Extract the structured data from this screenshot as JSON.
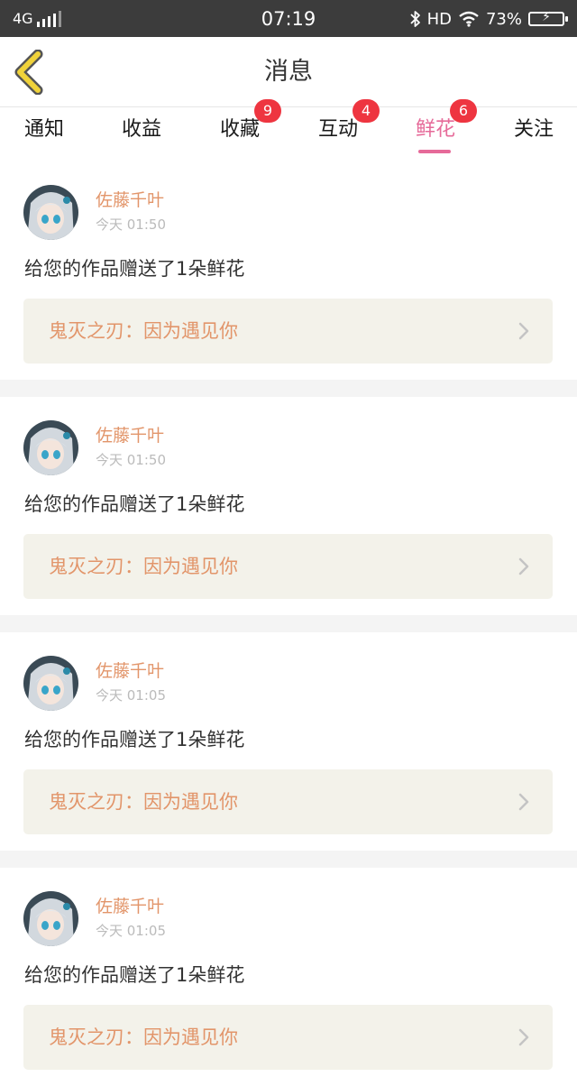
{
  "status_bar": {
    "network": "4G",
    "time": "07:19",
    "hd": "HD",
    "battery": "73%"
  },
  "header": {
    "title": "消息",
    "back_icon": "chevron-left-icon",
    "back_color": "#f0d23a"
  },
  "tabs": [
    {
      "label": "通知",
      "badge": "",
      "active": false
    },
    {
      "label": "收益",
      "badge": "",
      "active": false
    },
    {
      "label": "收藏",
      "badge": "9",
      "active": false
    },
    {
      "label": "互动",
      "badge": "4",
      "active": false
    },
    {
      "label": "鲜花",
      "badge": "6",
      "active": true
    },
    {
      "label": "关注",
      "badge": "",
      "active": false
    }
  ],
  "colors": {
    "accent": "#e66a99",
    "name": "#e2956a",
    "badge": "#ee3540",
    "work_bg": "#f3f2ea"
  },
  "messages": [
    {
      "user": "佐藤千叶",
      "time": "今天 01:50",
      "text": "给您的作品赠送了1朵鲜花",
      "work": "鬼灭之刃：因为遇见你"
    },
    {
      "user": "佐藤千叶",
      "time": "今天 01:50",
      "text": "给您的作品赠送了1朵鲜花",
      "work": "鬼灭之刃：因为遇见你"
    },
    {
      "user": "佐藤千叶",
      "time": "今天 01:05",
      "text": "给您的作品赠送了1朵鲜花",
      "work": "鬼灭之刃：因为遇见你"
    },
    {
      "user": "佐藤千叶",
      "time": "今天 01:05",
      "text": "给您的作品赠送了1朵鲜花",
      "work": "鬼灭之刃：因为遇见你"
    }
  ]
}
